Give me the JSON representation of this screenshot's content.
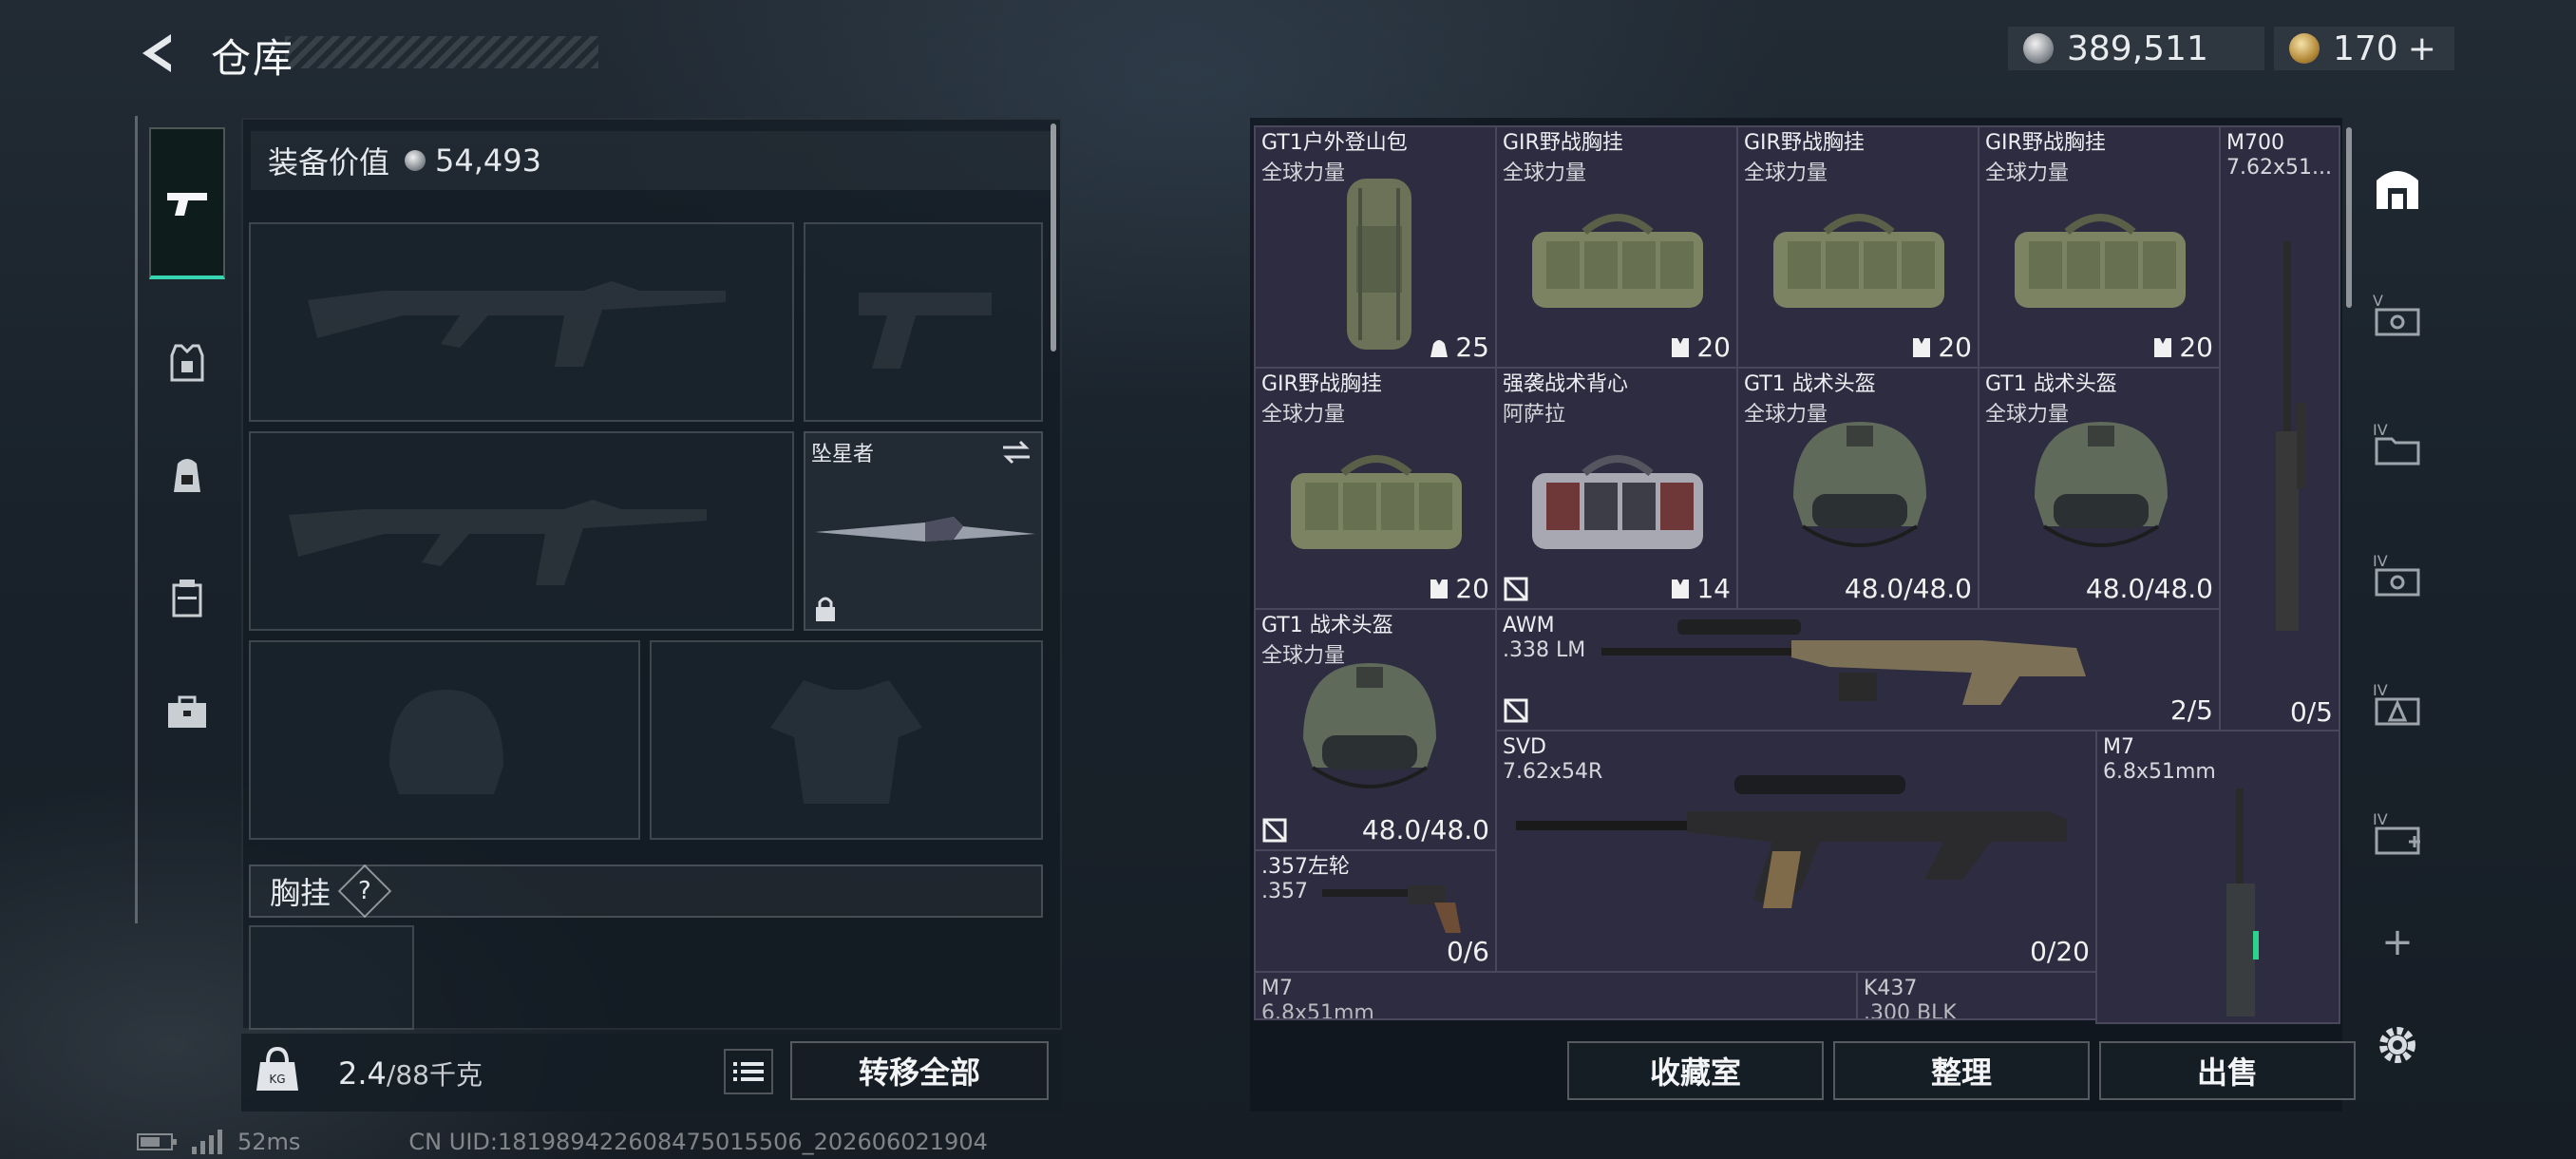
{
  "header": {
    "title": "仓库"
  },
  "currency": {
    "silver": "389,511",
    "gold": "170",
    "plus": "+"
  },
  "left": {
    "value_label": "装备价值",
    "value_amount": "54,493",
    "melee_name": "坠星者",
    "section_label": "胸挂",
    "help": "?",
    "weight_current": "2.4",
    "weight_max": "/88千克",
    "transfer_all": "转移全部"
  },
  "items": [
    {
      "name": "GT1户外登山包",
      "sub": "全球力量",
      "count": "25",
      "icon": "backpack-icon"
    },
    {
      "name": "GIR野战胸挂",
      "sub": "全球力量",
      "count": "20",
      "icon": "rig-icon"
    },
    {
      "name": "GIR野战胸挂",
      "sub": "全球力量",
      "count": "20",
      "icon": "rig-icon"
    },
    {
      "name": "GIR野战胸挂",
      "sub": "全球力量",
      "count": "20",
      "icon": "rig-icon"
    },
    {
      "name": "M700",
      "sub": "7.62x51...",
      "count": "0/5"
    },
    {
      "name": "GIR野战胸挂",
      "sub": "全球力量",
      "count": "20",
      "icon": "rig-icon"
    },
    {
      "name": "强袭战术背心",
      "sub": "阿萨拉",
      "count": "14",
      "icon": "rig-icon"
    },
    {
      "name": "GT1 战术头盔",
      "sub": "全球力量",
      "count": "48.0/48.0"
    },
    {
      "name": "GT1 战术头盔",
      "sub": "全球力量",
      "count": "48.0/48.0"
    },
    {
      "name": "GT1 战术头盔",
      "sub": "全球力量",
      "count": "48.0/48.0"
    },
    {
      "name": "AWM",
      "sub": ".338 LM",
      "count": "2/5"
    },
    {
      "name": "SVD",
      "sub": "7.62x54R",
      "count": "0/20"
    },
    {
      "name": "M7",
      "sub": "6.8x51mm",
      "count": ""
    },
    {
      "name": ".357左轮",
      "sub": ".357",
      "count": "0/6"
    },
    {
      "name": "M7",
      "sub": "6.8x51mm",
      "count": ""
    },
    {
      "name": "K437",
      "sub": ".300 BLK",
      "count": ""
    }
  ],
  "actions": {
    "collection": "收藏室",
    "sort": "整理",
    "sell": "出售"
  },
  "status": {
    "ping": "52ms",
    "uid": "CN UID:181989422608475015506_202606021904"
  }
}
